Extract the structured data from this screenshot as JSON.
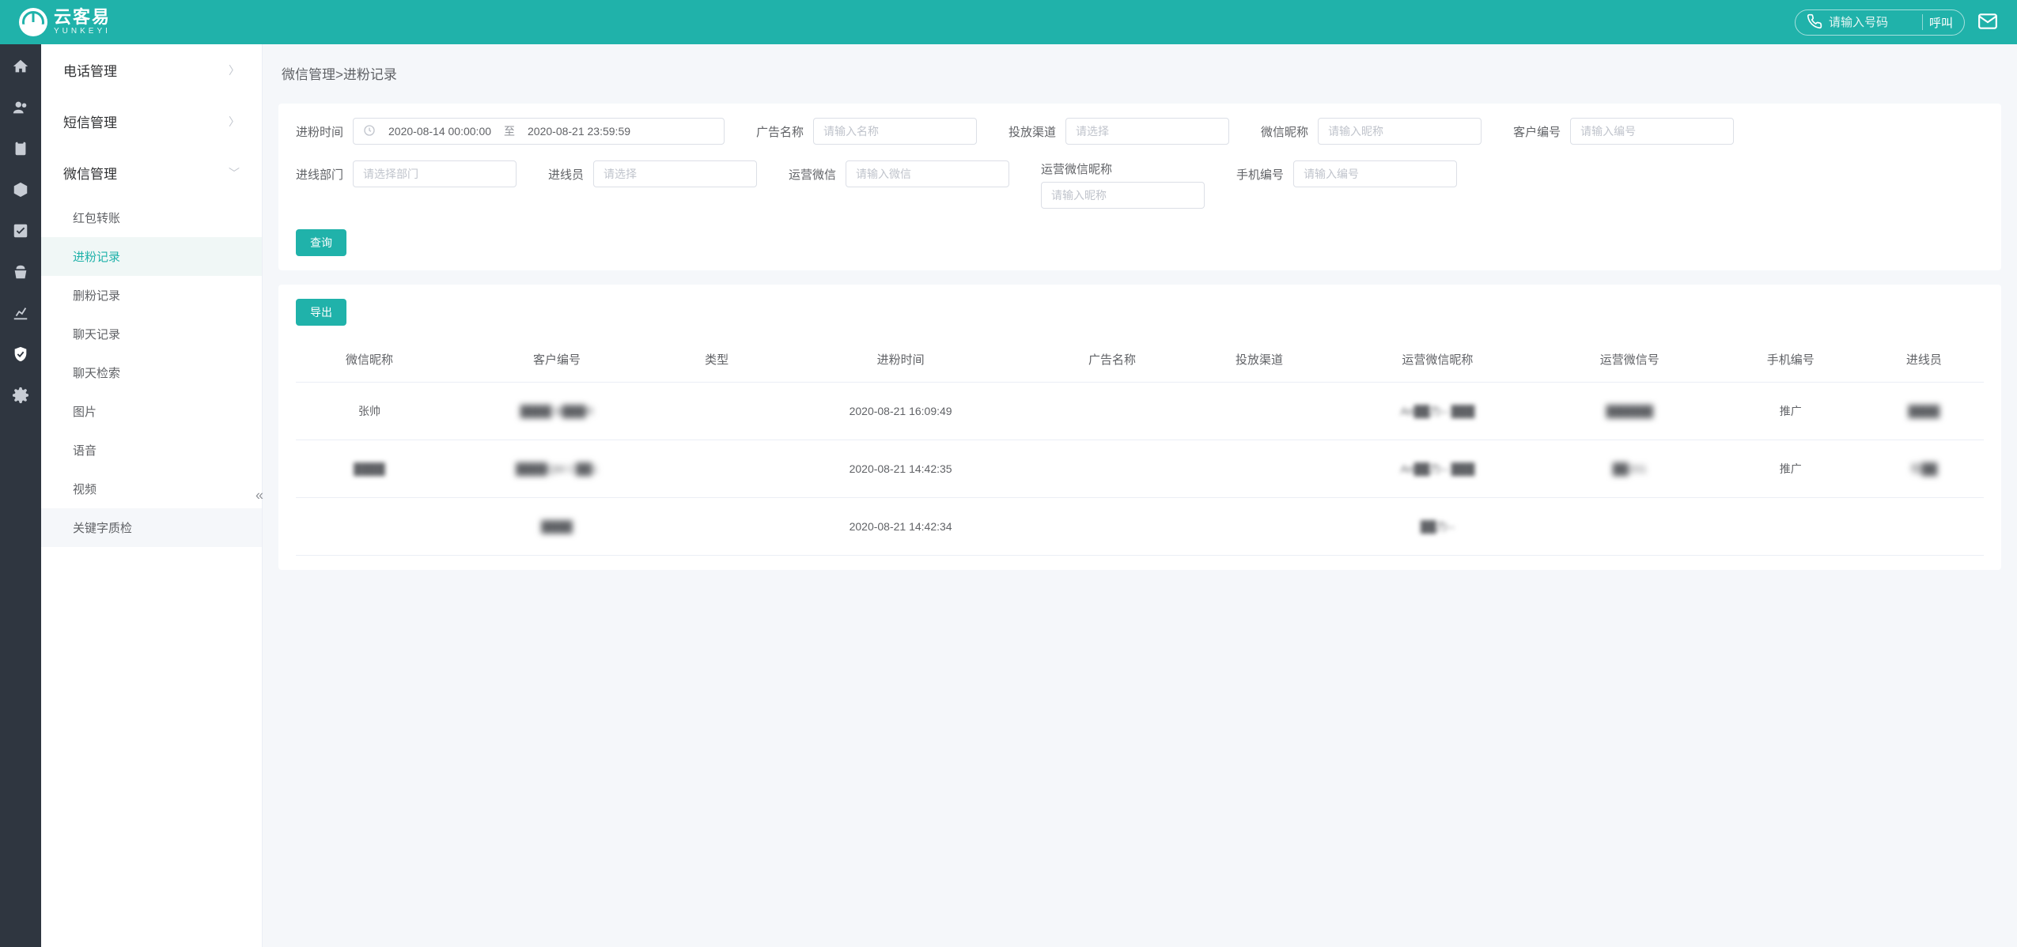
{
  "brand": {
    "cn": "云客易",
    "en": "YUNKEYI"
  },
  "header": {
    "dial_placeholder": "请输入号码",
    "call_label": "呼叫"
  },
  "sidebar": {
    "groups": [
      {
        "label": "电话管理",
        "expanded": false
      },
      {
        "label": "短信管理",
        "expanded": false
      },
      {
        "label": "微信管理",
        "expanded": true
      }
    ],
    "wechat_items": [
      {
        "label": "红包转账",
        "active": false
      },
      {
        "label": "进粉记录",
        "active": true
      },
      {
        "label": "删粉记录",
        "active": false
      },
      {
        "label": "聊天记录",
        "active": false
      },
      {
        "label": "聊天检索",
        "active": false
      },
      {
        "label": "图片",
        "active": false
      },
      {
        "label": "语音",
        "active": false
      },
      {
        "label": "视频",
        "active": false
      },
      {
        "label": "关键字质检",
        "active": false,
        "hover": true
      }
    ]
  },
  "breadcrumb": "微信管理>进粉记录",
  "filters": {
    "time_label": "进粉时间",
    "time_from": "2020-08-14 00:00:00",
    "time_sep": "至",
    "time_to": "2020-08-21 23:59:59",
    "ad_label": "广告名称",
    "ad_ph": "请输入名称",
    "channel_label": "投放渠道",
    "channel_ph": "请选择",
    "nick_label": "微信昵称",
    "nick_ph": "请输入昵称",
    "cust_label": "客户编号",
    "cust_ph": "请输入编号",
    "dept_label": "进线部门",
    "dept_ph": "请选择部门",
    "agent_label": "进线员",
    "agent_ph": "请选择",
    "opwx_label": "运营微信",
    "opwx_ph": "请输入微信",
    "opnick_label": "运营微信昵称",
    "opnick_ph": "请输入昵称",
    "phone_label": "手机编号",
    "phone_ph": "请输入编号",
    "search_btn": "查询",
    "export_btn": "导出"
  },
  "table": {
    "cols": [
      "微信昵称",
      "客户编号",
      "类型",
      "进粉时间",
      "广告名称",
      "投放渠道",
      "运营微信昵称",
      "运营微信号",
      "手机编号",
      "进线员"
    ],
    "rows": [
      {
        "nick": "张帅",
        "cust": "████ B███R",
        "type": "",
        "time": "2020-08-21 16:09:49",
        "ad": "",
        "channel": "",
        "opnick": "An██力-- ███",
        "opwx": "██████",
        "phone": "推广",
        "agent": "████"
      },
      {
        "nick": "████",
        "cust": "████QM C██1",
        "type": "",
        "time": "2020-08-21 14:42:35",
        "ad": "",
        "channel": "",
        "opnick": "An██力-- ███",
        "opwx": "██201",
        "phone": "推广",
        "agent": "程██"
      },
      {
        "nick": "",
        "cust": "████",
        "type": "",
        "time": "2020-08-21 14:42:34",
        "ad": "",
        "channel": "",
        "opnick": "██力--",
        "opwx": "",
        "phone": "",
        "agent": ""
      }
    ]
  }
}
